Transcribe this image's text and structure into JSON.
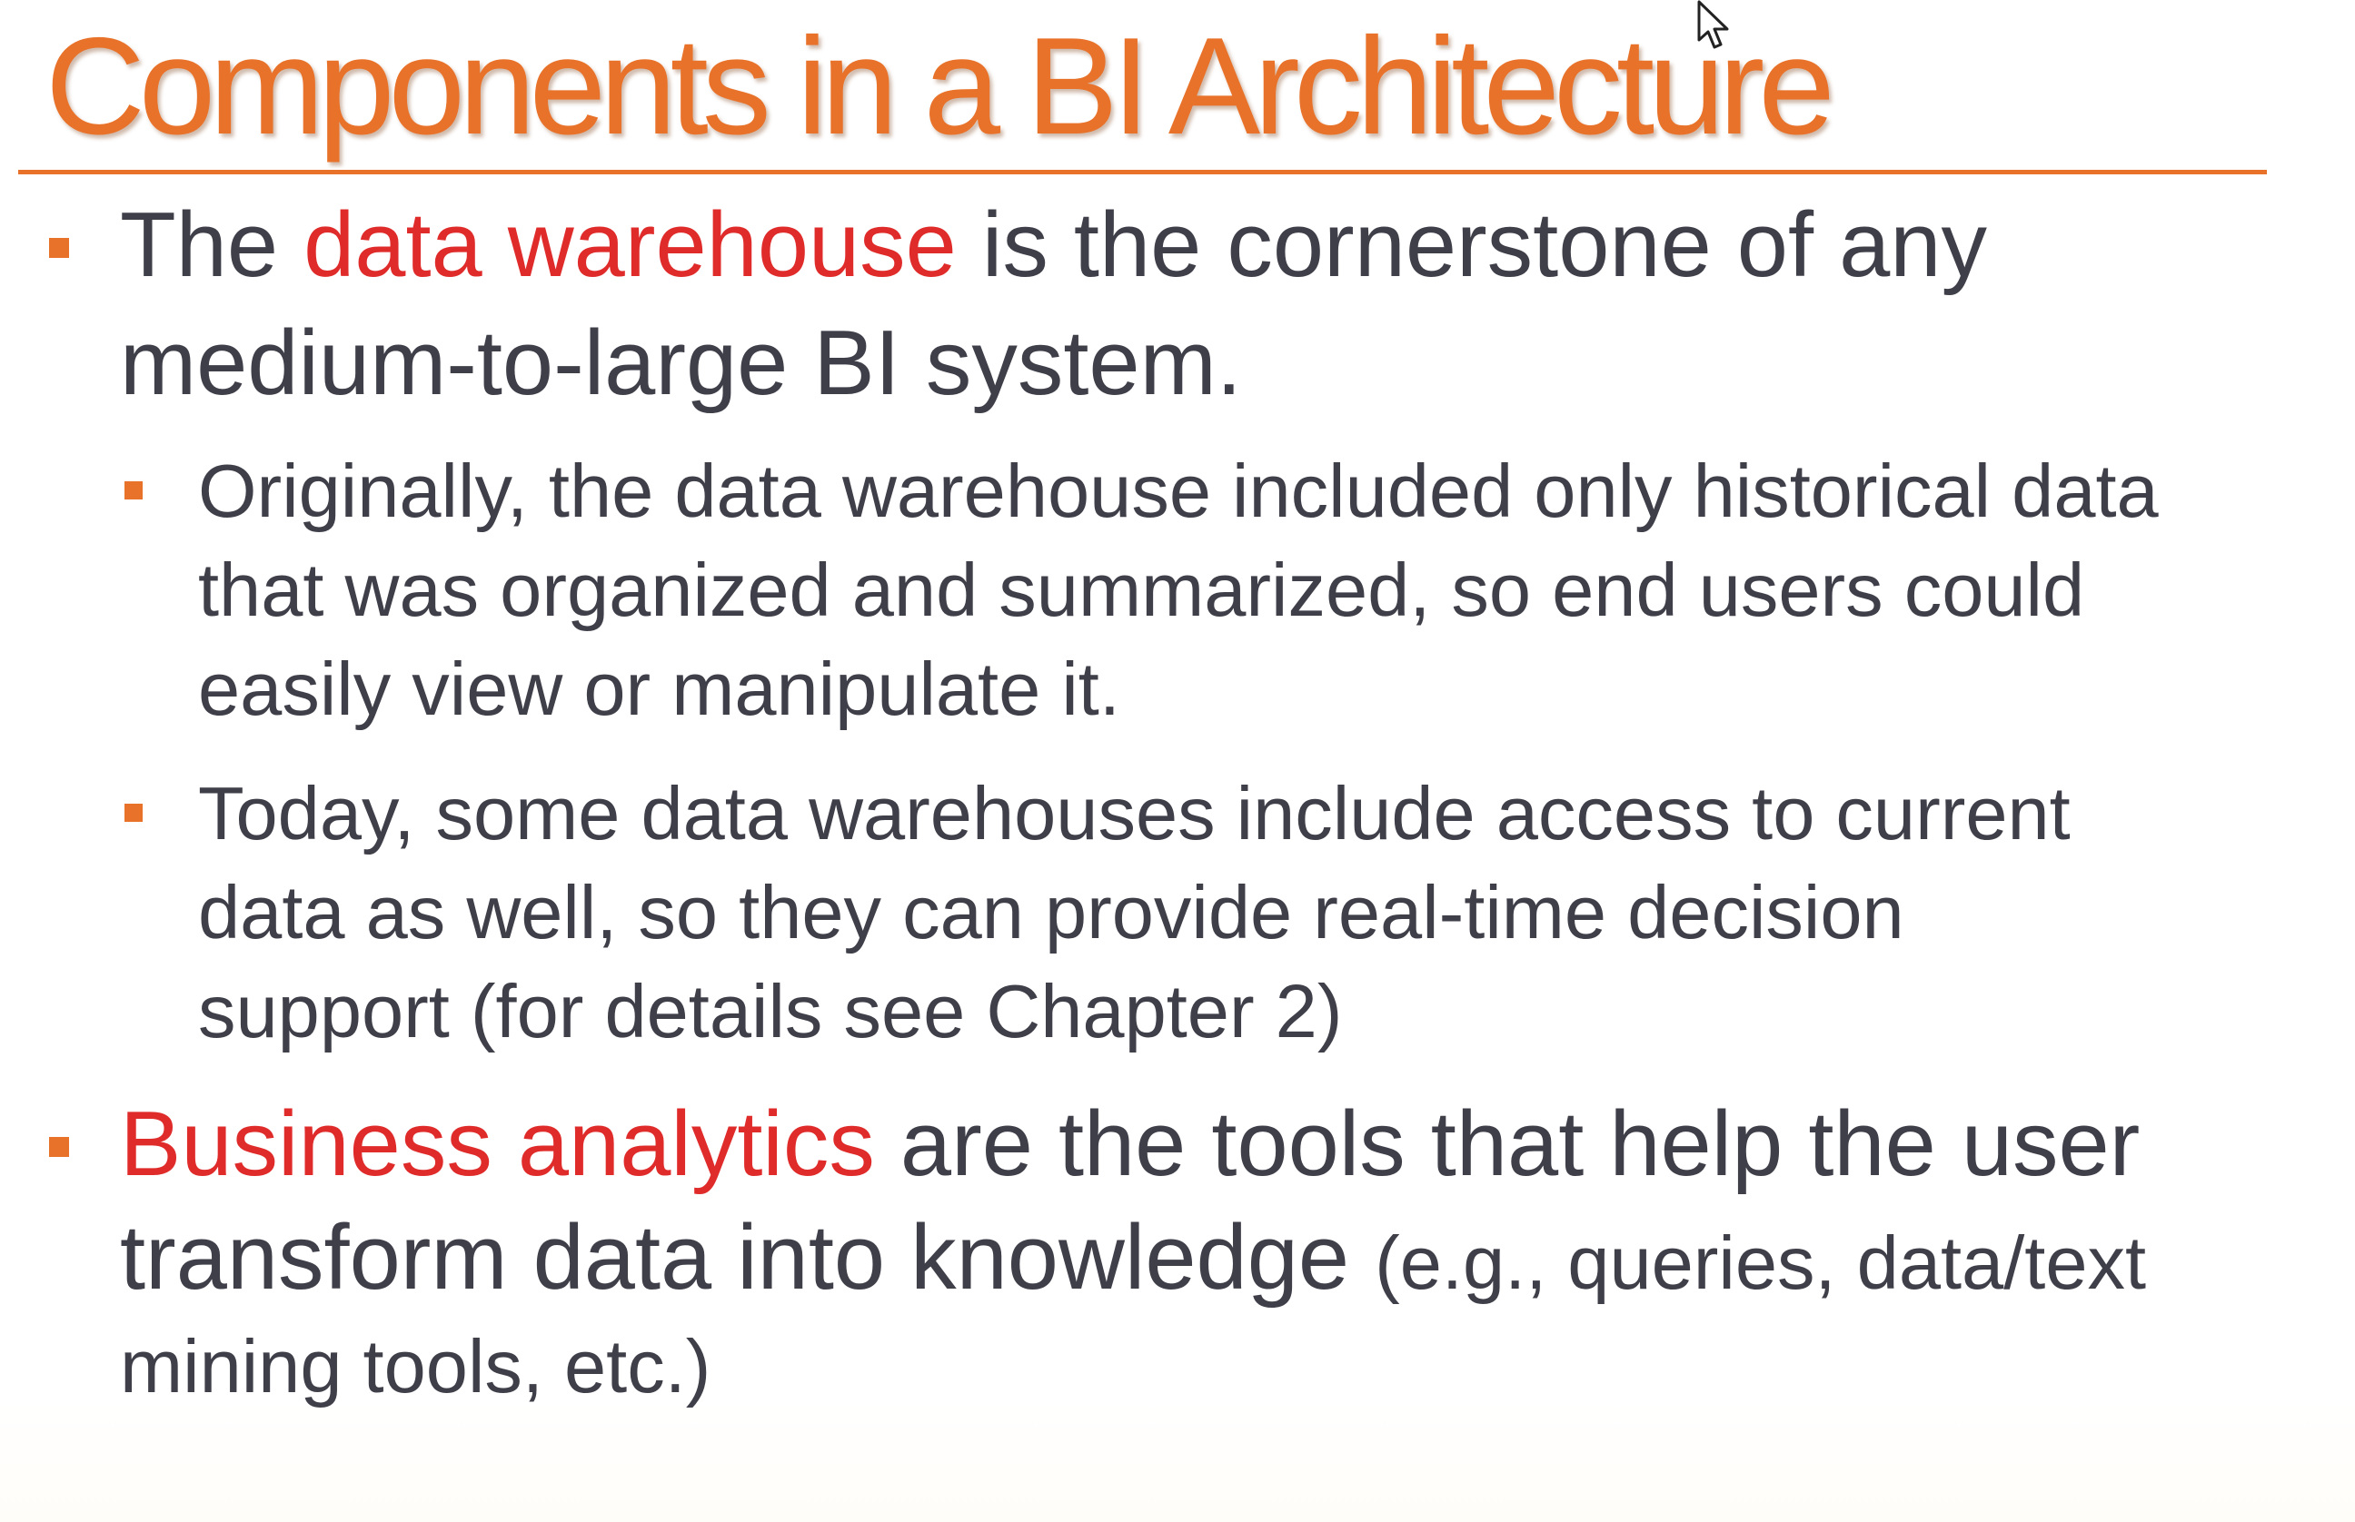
{
  "slide": {
    "title": "Components in a BI Architecture",
    "bullets": [
      {
        "line1_pre": "The ",
        "line1_highlight": "data warehouse",
        "line1_post": " is the cornerstone of any",
        "line2": "medium-to-large BI system.",
        "sub_bullets": [
          {
            "lines": [
              "Originally, the data warehouse included only historical data",
              "that was organized and summarized, so end users could",
              "easily view or manipulate it."
            ]
          },
          {
            "lines": [
              "Today, some data warehouses include access to current",
              "data as well, so they can provide real-time decision",
              "support (for details see Chapter 2)"
            ]
          }
        ]
      },
      {
        "line1_highlight": "Business analytics",
        "line1_post": " are the tools that help the user",
        "line2_main": "transform data into knowledge ",
        "line2_small": "(e.g., queries, data/text",
        "line3": "mining tools, etc.)"
      }
    ]
  },
  "colors": {
    "accent": "#e8722a",
    "highlight": "#e02b2b",
    "body_text": "#3f3f4a"
  },
  "icons": {
    "cursor": "mouse-pointer-icon",
    "bullet": "square-bullet-icon"
  }
}
